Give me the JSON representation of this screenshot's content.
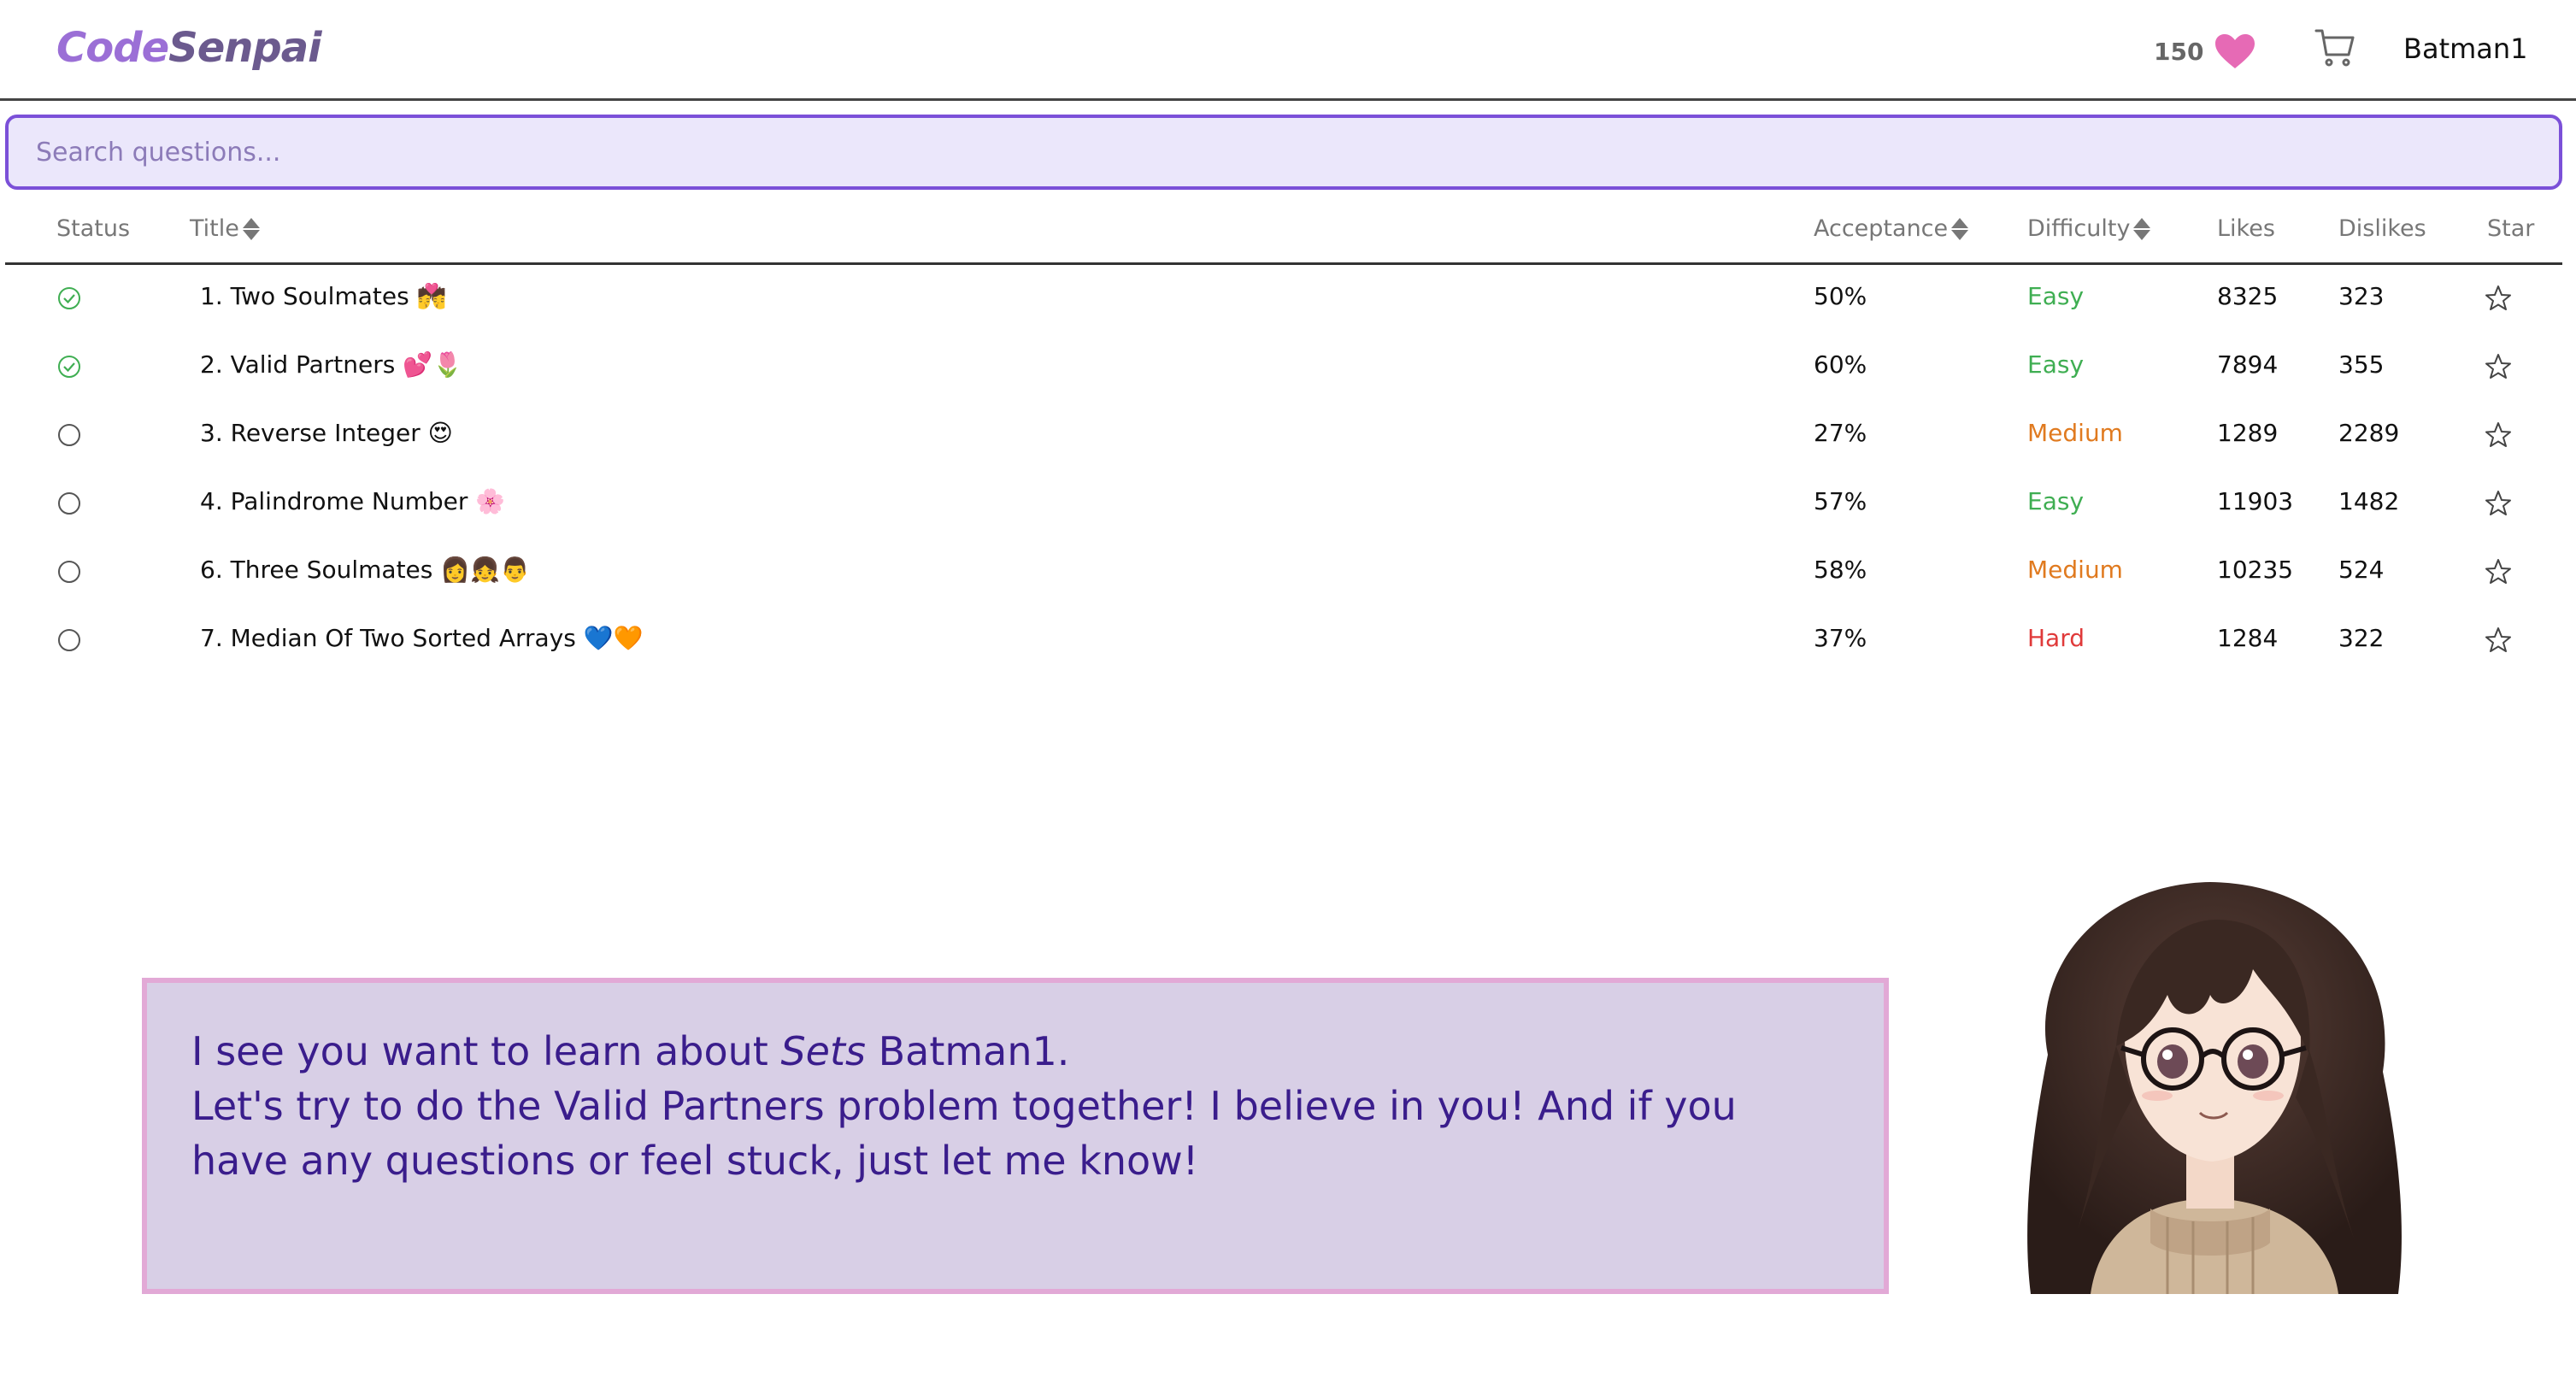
{
  "brand": {
    "part1": "Code",
    "part2": "Senpai"
  },
  "header": {
    "hearts_count": "150",
    "username": "Batman1"
  },
  "search": {
    "placeholder": "Search questions..."
  },
  "table": {
    "headers": {
      "status": "Status",
      "title": "Title",
      "acceptance": "Acceptance",
      "difficulty": "Difficulty",
      "likes": "Likes",
      "dislikes": "Dislikes",
      "star": "Star"
    },
    "rows": [
      {
        "title": "1. Two Soulmates 💏",
        "solved": true,
        "acceptance": "50%",
        "difficulty": "Easy",
        "likes": "8325",
        "dislikes": "323"
      },
      {
        "title": "2. Valid Partners 💕🌷",
        "solved": true,
        "acceptance": "60%",
        "difficulty": "Easy",
        "likes": "7894",
        "dislikes": "355"
      },
      {
        "title": "3. Reverse Integer 😍",
        "solved": false,
        "acceptance": "27%",
        "difficulty": "Medium",
        "likes": "1289",
        "dislikes": "2289"
      },
      {
        "title": "4. Palindrome Number 🌸",
        "solved": false,
        "acceptance": "57%",
        "difficulty": "Easy",
        "likes": "11903",
        "dislikes": "1482"
      },
      {
        "title": "6. Three Soulmates 👩👧👨",
        "solved": false,
        "acceptance": "58%",
        "difficulty": "Medium",
        "likes": "10235",
        "dislikes": "524"
      },
      {
        "title": "7. Median Of Two Sorted Arrays 💙🧡",
        "solved": false,
        "acceptance": "37%",
        "difficulty": "Hard",
        "likes": "1284",
        "dislikes": "322"
      }
    ]
  },
  "chat": {
    "line1_prefix": "I see you want to learn about ",
    "line1_topic": "Sets",
    "line1_suffix": " Batman1.",
    "line2": "Let's try to do the Valid Partners problem together! I believe in you! And if you have any questions or feel stuck, just let me know!"
  },
  "colors": {
    "accent": "#7b50d8",
    "easy": "#3fae52",
    "medium": "#e07a1f",
    "hard": "#e03a3a",
    "heart": "#e66ab5",
    "bubble_bg": "#d8cfe6",
    "bubble_border": "#e2a9d6",
    "bubble_text": "#3a1d8c"
  },
  "icons": {
    "heart": "heart-icon",
    "cart": "cart-icon",
    "solved": "check-circle-icon",
    "unsolved": "empty-circle-icon",
    "star": "star-outline-icon",
    "sort": "sort-icon"
  }
}
